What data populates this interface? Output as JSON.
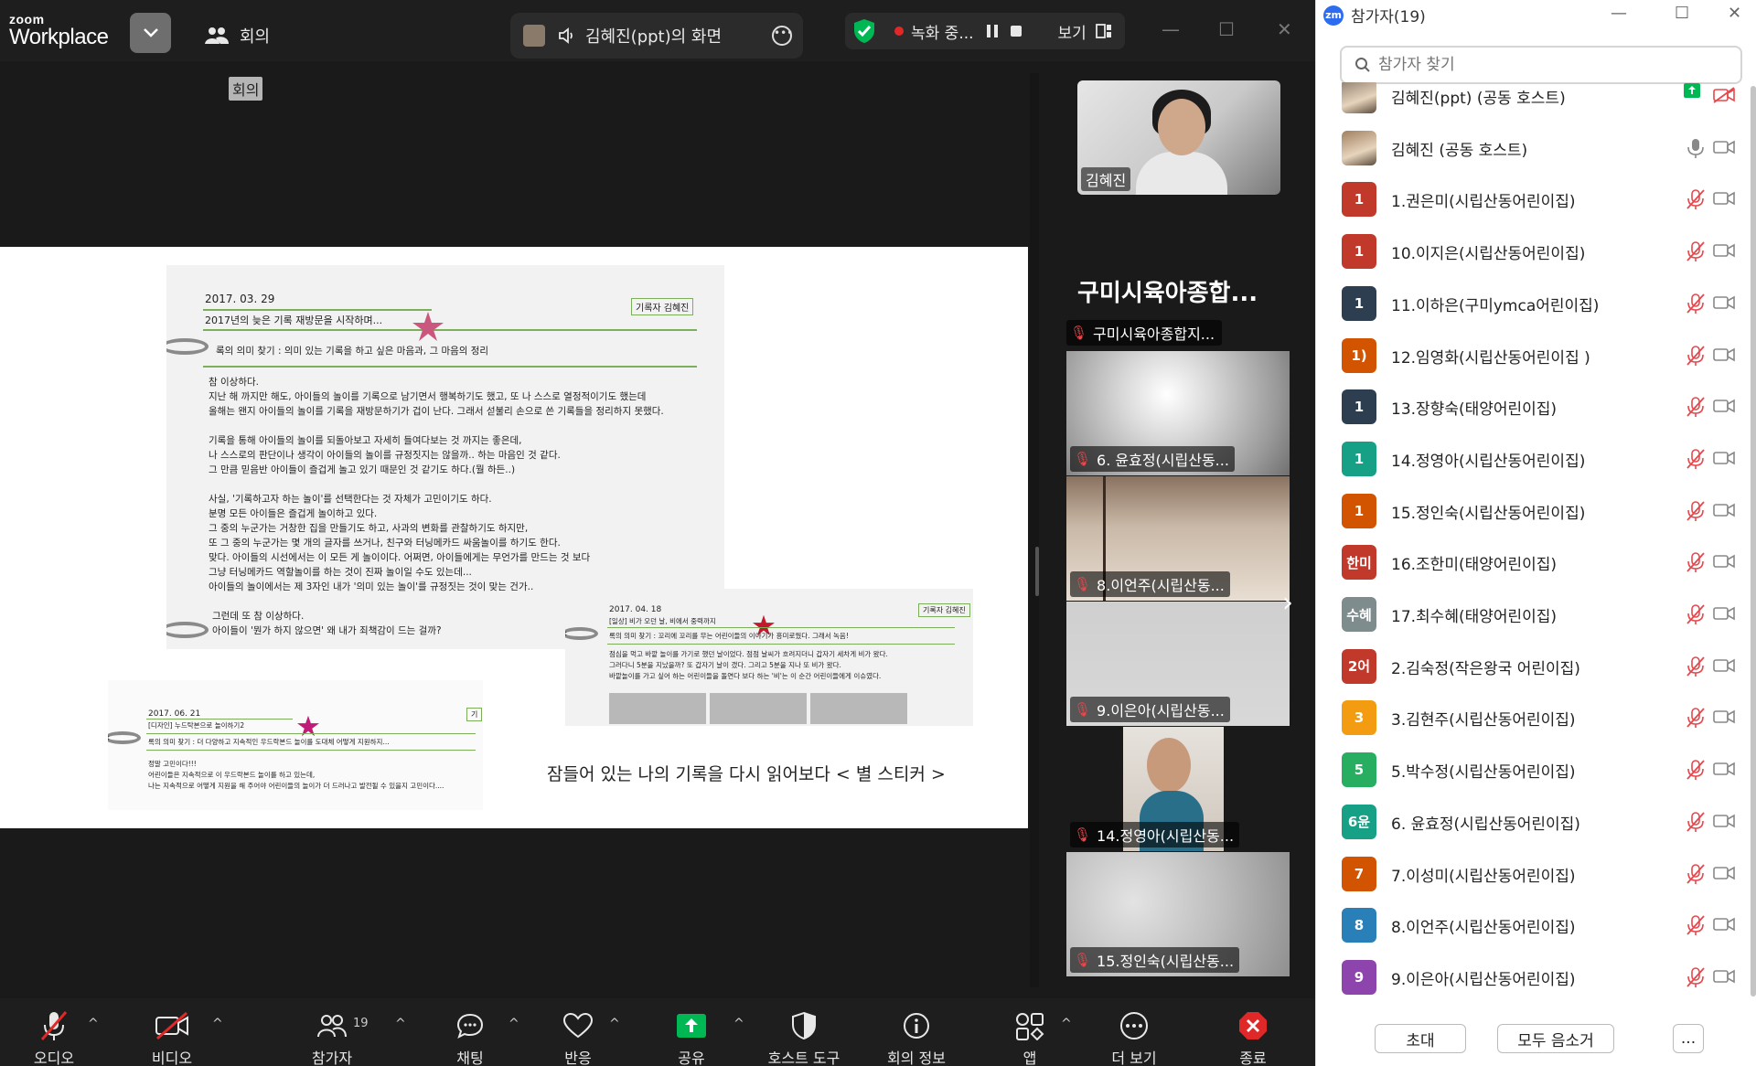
{
  "app": {
    "logo_small": "zoom",
    "logo_big": "Workplace",
    "meeting_label": "회의",
    "tooltip": "회의"
  },
  "share_banner": {
    "title": "김혜진(ppt)의 화면"
  },
  "recording": {
    "status": "녹화 중...",
    "view_label": "보기"
  },
  "slide": {
    "doc1": {
      "date": "2017. 03. 29",
      "subtitle": "2017년의 늦은 기록 재방문을 시작하며...",
      "tag": "기록자 김혜진",
      "lines": [
        "록의 의미 찾기 : 의미 있는 기록을 하고 싶은 마음과, 그 마음의 정리",
        "참 이상하다.",
        "지난 해 까지만 해도, 아이들의 놀이를 기록으로 남기면서 행복하기도 했고, 또 나 스스로 열정적이기도 했는데",
        "올해는 왠지 아이들의 놀이를 기록을 재방문하기가 겁이 난다. 그래서 섣불리 손으로 쓴 기록들을 정리하지 못했다.",
        "기록을 통해 아이들의 놀이를 되돌아보고 자세히 들여다보는 것 까지는 좋은데,",
        "나 스스로의 판단이나 생각이 아이들의 놀이를 규정짓지는 않을까.. 하는 마음인 것 같다.",
        "그 만큼 믿음반 아이들이 즐겁게 놀고 있기 때문인 것 같기도 하다.(뭘 하든..)",
        "사실, '기록하고자 하는 놀이'를 선택한다는 것 자체가 고민이기도 하다.",
        "분명 모든 아이들은 즐겁게 놀이하고 있다.",
        "그 중의 누군가는 거창한 집을 만들기도 하고, 사과의 변화를 관찰하기도 하지만,",
        "또 그 중의 누군가는 몇 개의 글자를 쓰거나, 친구와 터닝메카드 싸움놀이를 하기도 한다.",
        "맞다. 아이들의 시선에서는 이 모든 게 놀이이다. 어쩌면, 아이들에게는 무언가를 만드는 것 보다",
        "그냥 터닝메카드 역할놀이를 하는 것이 진짜 놀이일 수도 있는데...",
        "아이들의 놀이에서는 제 3자인 내가 '의미 있는 놀이'를 규정짓는 것이 맞는 건가..",
        "그런데 또 참 이상하다.",
        "아이들이 '뭔가 하지 않으면' 왜 내가 죄책감이 드는 걸까?"
      ]
    },
    "doc2": {
      "date": "2017. 04. 18",
      "tag": "기록자 김혜진",
      "lines": [
        "[일상] 비가 오던 날, 비에서 중력까지",
        "록의 의미 찾기 : 꼬리에 꼬리를 무는 어린이들의 이야기가 흥미로웠다. 그래서 녹음!",
        "점심을 먹고 바깥 놀이를 가기로 했던 날이었다. 점점 날씨가 흐려지더니 갑자기 세차게 비가 왔다.",
        "그러다니 5분을 지났을까? 또 갑자기 날이 갰다. 그리고 5분을 지나 또 비가 왔다.",
        "바깥놀이를 가고 싶어 하는 어린이들을 돌연다 보다 하는 '비'는 이 순간 어린이들에게 이슈였다."
      ]
    },
    "doc3": {
      "date": "2017. 06. 21",
      "tag": "기",
      "lines": [
        "[디자인] 누드탁본으로 놀이하기2",
        "록의 의미 찾기 : 더 다양하고 지속적인 우드락본드 놀이를 도대체 어떻게 지원하지...",
        "정말 고민이다!!!",
        "어린이들은 지속적으로 이 우드락본드 놀이를 하고 있는데,",
        "나는 지속적으로 어떻게 지원을 해 주어야 어린이들의 놀이가 더 드러나고 발전될 수 있을지 고민이다...."
      ]
    },
    "caption": "잠들어 있는 나의 기록을 다시 읽어보다 < 별 스티커 >"
  },
  "gallery": {
    "host_tile_name": "김혜진",
    "room_title": "구미시육아종합...",
    "room_label": "구미시육아종합지...",
    "tiles": [
      {
        "name": "6. 윤효정(시립산동..."
      },
      {
        "name": "8.이언주(시립산동..."
      },
      {
        "name": "9.이은아(시립산동..."
      },
      {
        "name": "14.정영아(시립산동..."
      },
      {
        "name": "15.정인숙(시립산동..."
      }
    ]
  },
  "toolbar": {
    "audio": "오디오",
    "video": "비디오",
    "participants": "참가자",
    "participants_count": "19",
    "chat": "채팅",
    "reactions": "반응",
    "share": "공유",
    "host_tools": "호스트 도구",
    "meeting_info": "회의 정보",
    "apps": "앱",
    "more": "더 보기",
    "end": "종료"
  },
  "panel": {
    "title": "참가자(19)",
    "search_placeholder": "참가자 찾기",
    "invite": "초대",
    "mute_all": "모두 음소거",
    "more": "...",
    "participants": [
      {
        "avatar": "",
        "avatar_color": "#8a7a6a",
        "name": "김혜진(ppt) (공동 호스트)",
        "muted": true,
        "video_off": true,
        "sharing": true
      },
      {
        "avatar": "",
        "avatar_color": "#a08060",
        "name": "김혜진 (공동 호스트)",
        "muted": false,
        "video_off": false
      },
      {
        "avatar": "1",
        "avatar_color": "#c0392b",
        "name": "1.권은미(시립산동어린이집)",
        "muted": true,
        "video_off": false
      },
      {
        "avatar": "1",
        "avatar_color": "#c0392b",
        "name": "10.이지은(시립산동어린이집)",
        "muted": true,
        "video_off": false
      },
      {
        "avatar": "1",
        "avatar_color": "#2c3e50",
        "name": "11.이하은(구미ymca어린이집)",
        "muted": true,
        "video_off": false
      },
      {
        "avatar": "1)",
        "avatar_color": "#d35400",
        "name": "12.임영화(시립산동어린이집 )",
        "muted": true,
        "video_off": false
      },
      {
        "avatar": "1",
        "avatar_color": "#2c3e50",
        "name": "13.장향숙(태양어린이집)",
        "muted": true,
        "video_off": false
      },
      {
        "avatar": "1",
        "avatar_color": "#16a085",
        "name": "14.정영아(시립산동어린이집)",
        "muted": true,
        "video_off": false
      },
      {
        "avatar": "1",
        "avatar_color": "#d35400",
        "name": "15.정인숙(시립산동어린이집)",
        "muted": true,
        "video_off": false
      },
      {
        "avatar": "한미",
        "avatar_color": "#c0392b",
        "name": "16.조한미(태양어린이집)",
        "muted": true,
        "video_off": false
      },
      {
        "avatar": "수혜",
        "avatar_color": "#7f8c8d",
        "name": "17.최수혜(태양어린이집)",
        "muted": true,
        "video_off": false
      },
      {
        "avatar": "2어",
        "avatar_color": "#c0392b",
        "name": "2.김숙정(작은왕국 어린이집)",
        "muted": true,
        "video_off": false
      },
      {
        "avatar": "3",
        "avatar_color": "#f39c12",
        "name": "3.김현주(시립산동어린이집)",
        "muted": true,
        "video_off": false
      },
      {
        "avatar": "5",
        "avatar_color": "#27ae60",
        "name": "5.박수정(시립산동어린이집)",
        "muted": true,
        "video_off": false
      },
      {
        "avatar": "6윤",
        "avatar_color": "#16a085",
        "name": "6. 윤효정(시립산동어린이집)",
        "muted": true,
        "video_off": false
      },
      {
        "avatar": "7",
        "avatar_color": "#d35400",
        "name": "7.이성미(시립산동어린이집)",
        "muted": true,
        "video_off": false
      },
      {
        "avatar": "8",
        "avatar_color": "#2980b9",
        "name": "8.이언주(시립산동어린이집)",
        "muted": true,
        "video_off": false
      },
      {
        "avatar": "9",
        "avatar_color": "#8e44ad",
        "name": "9.이은아(시립산동어린이집)",
        "muted": true,
        "video_off": false
      }
    ]
  },
  "colors": {
    "accent_green": "#00b853",
    "mute_red": "#e5484d",
    "end_red": "#e02828",
    "zoom_blue": "#2d6cf0"
  }
}
